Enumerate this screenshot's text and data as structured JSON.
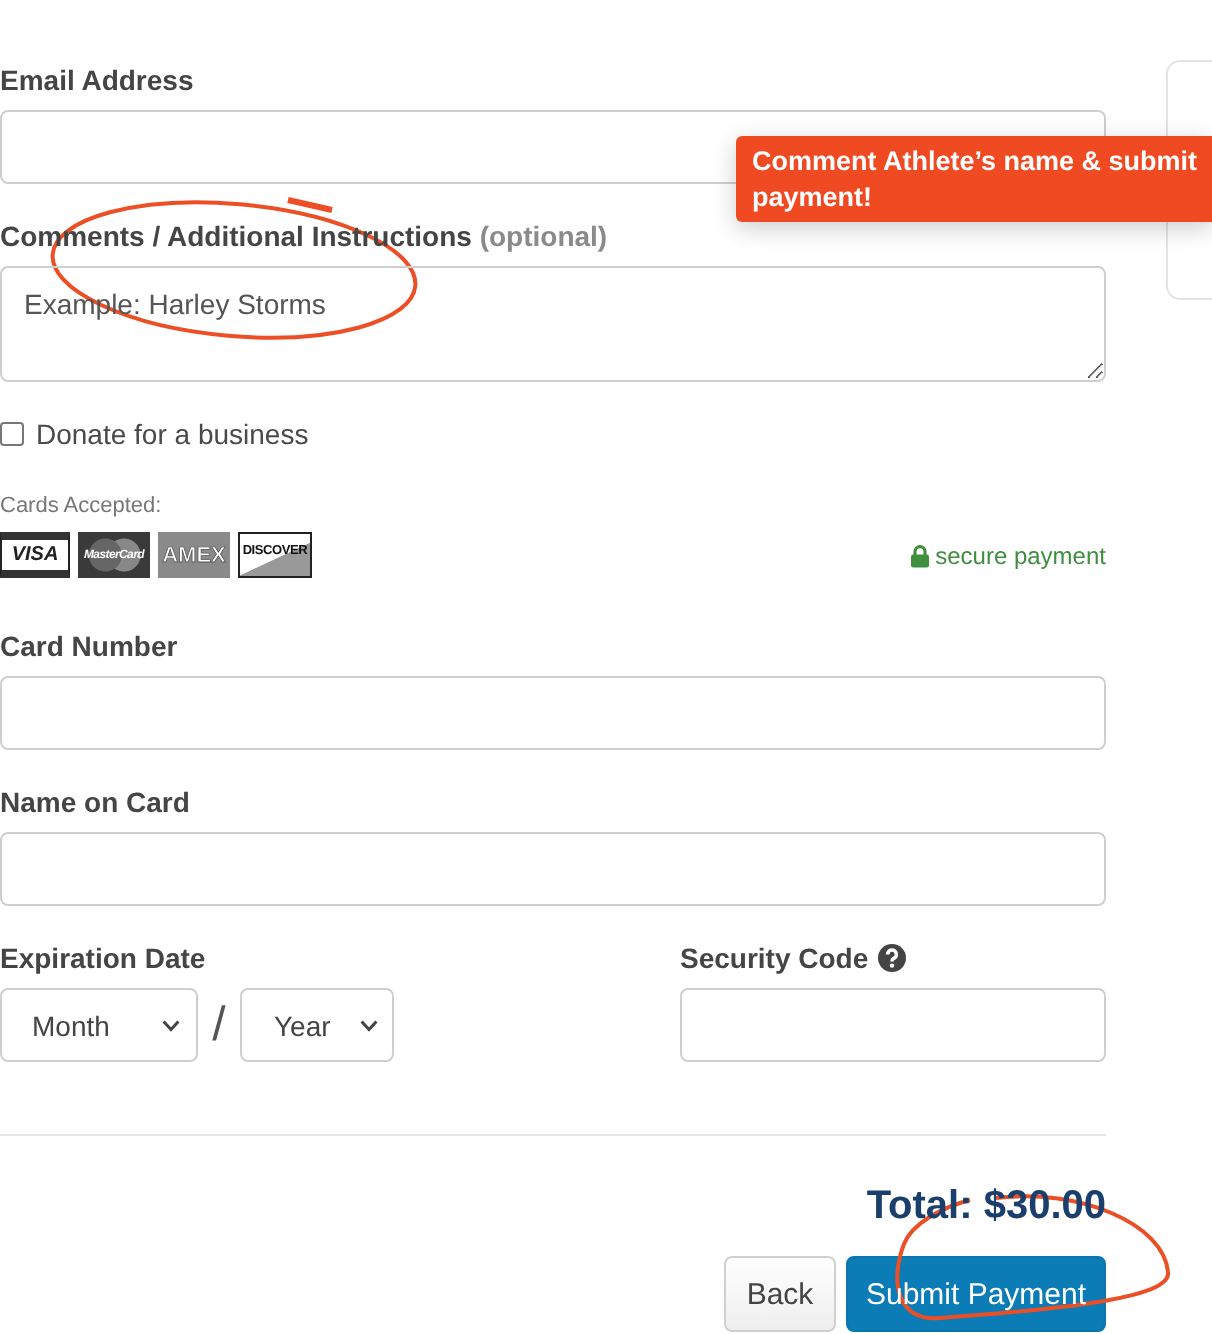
{
  "form": {
    "email": {
      "label": "Email Address"
    },
    "comments": {
      "label": "Comments / Additional Instructions",
      "hint": "(optional)",
      "placeholder": "Example: Harley Storms"
    },
    "donate_business": {
      "label": "Donate for a business",
      "checked": false
    },
    "cards_accepted": {
      "label": "Cards Accepted:",
      "cards": [
        {
          "label": "VISA",
          "kind": "visa"
        },
        {
          "label": "MasterCard",
          "kind": "mastercard"
        },
        {
          "label": "AMEX",
          "kind": "amex"
        },
        {
          "label": "DISCOVER",
          "kind": "discover"
        }
      ]
    },
    "secure": {
      "label": "secure payment"
    },
    "card_number": {
      "label": "Card Number"
    },
    "name_on_card": {
      "label": "Name on Card"
    },
    "expiration": {
      "label": "Expiration Date",
      "month": "Month",
      "separator": "/",
      "year": "Year"
    },
    "security_code": {
      "label": "Security Code"
    }
  },
  "total": "Total: $30.00",
  "buttons": [
    {
      "label": "Back",
      "kind": "secondary"
    },
    {
      "label": "Submit Payment",
      "kind": "primary"
    }
  ],
  "tooltip": {
    "text": "Comment Athlete’s name & submit payment!"
  }
}
